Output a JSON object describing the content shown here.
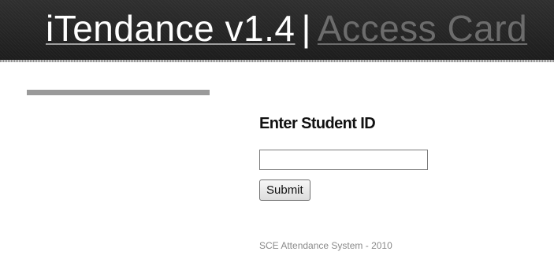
{
  "header": {
    "app_name": "iTendance v1.4",
    "separator": "|",
    "section": "Access Card"
  },
  "form": {
    "heading": "Enter Student ID",
    "student_id_value": "",
    "submit_label": "Submit"
  },
  "footer": {
    "text": "SCE Attendance System - 2010"
  },
  "colors": {
    "header_bg": "#1c1c1c",
    "header_text": "#ffffff",
    "section_link": "#6c6c6c",
    "sidebar_bar": "#9a9a9a",
    "footer_text": "#8a8a8a"
  }
}
